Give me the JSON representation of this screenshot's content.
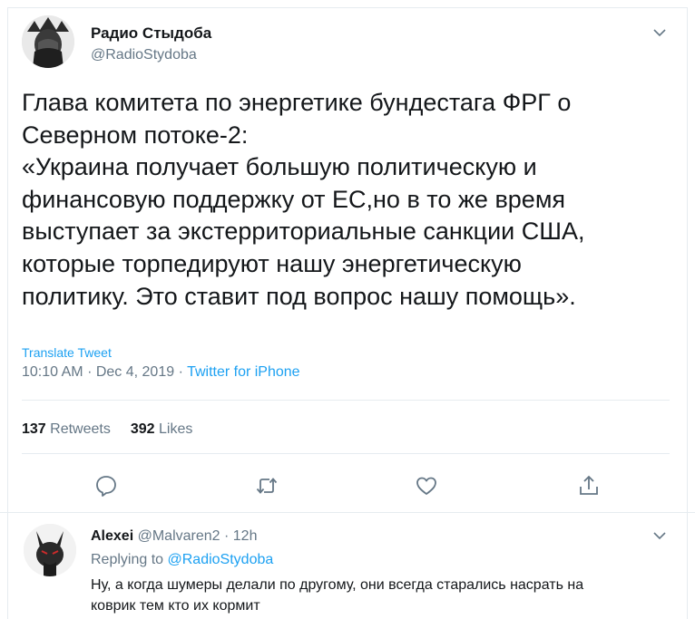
{
  "tweet": {
    "author_name": "Радио Стыдоба",
    "author_handle": "@RadioStydoba",
    "text_lines": [
      "Глава комитета по энергетике бундестага ФРГ о",
      "Северном потоке-2:",
      "«Украина получает большую политическую и",
      "финансовую поддержку от ЕС,но в то же время",
      "выступает за экстерриториальные санкции США,",
      "которые торпедируют нашу энергетическую",
      "политику. Это ставит под вопрос нашу помощь»."
    ],
    "translate_label": "Translate Tweet",
    "time": "10:10 AM",
    "date": "Dec 4, 2019",
    "separator": "·",
    "source": "Twitter for iPhone"
  },
  "stats": {
    "retweets_count": "137",
    "retweets_label": "Retweets",
    "likes_count": "392",
    "likes_label": "Likes"
  },
  "actions": {
    "reply_icon": "speech-bubble-icon",
    "retweet_icon": "retweet-arrows-icon",
    "like_icon": "heart-icon",
    "share_icon": "share-arrow-icon"
  },
  "reply": {
    "author_name": "Alexei",
    "author_handle": "@Malvaren2",
    "separator": "·",
    "time_ago": "12h",
    "replying_to_label": "Replying to",
    "replying_to_handle": "@RadioStydoba",
    "text_lines": [
      "Ну, а когда шумеры делали по другому, они всегда старались насрать на",
      "коврик тем кто их кормит"
    ]
  },
  "colors": {
    "link": "#1da1f2",
    "secondary_text": "#657786",
    "primary_text": "#14171a",
    "border": "#e6ecf0"
  }
}
